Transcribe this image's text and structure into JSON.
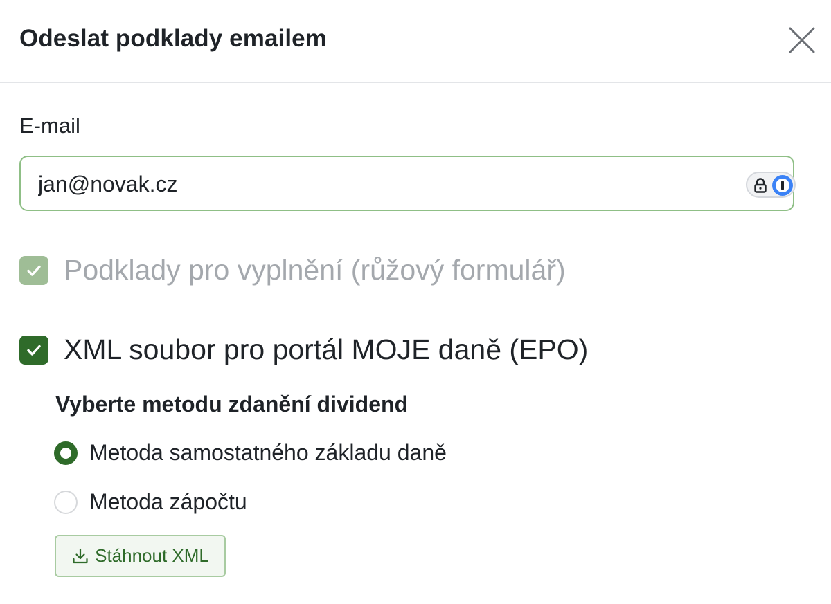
{
  "modal": {
    "title": "Odeslat podklady emailem",
    "close_icon": "close-icon"
  },
  "email": {
    "label": "E-mail",
    "value": "jan@novak.cz",
    "password_manager_icons": [
      "lock-icon",
      "password-manager-icon"
    ]
  },
  "options": {
    "pink_form": {
      "label": "Podklady pro vyplnění (růžový formulář)",
      "checked": true,
      "disabled": true
    },
    "xml_file": {
      "label": "XML soubor pro portál MOJE daně (EPO)",
      "checked": true,
      "disabled": false
    }
  },
  "dividend_method": {
    "title": "Vyberte metodu zdanění dividend",
    "options": [
      {
        "label": "Metoda samostatného základu daně",
        "selected": true
      },
      {
        "label": "Metoda zápočtu",
        "selected": false
      }
    ]
  },
  "download": {
    "label": "Stáhnout XML",
    "icon": "download-icon"
  },
  "colors": {
    "primary_green": "#2f6b2a",
    "disabled_green": "#9fbd96",
    "field_border": "#8fbf86",
    "password_manager_blue": "#3b82f6"
  }
}
